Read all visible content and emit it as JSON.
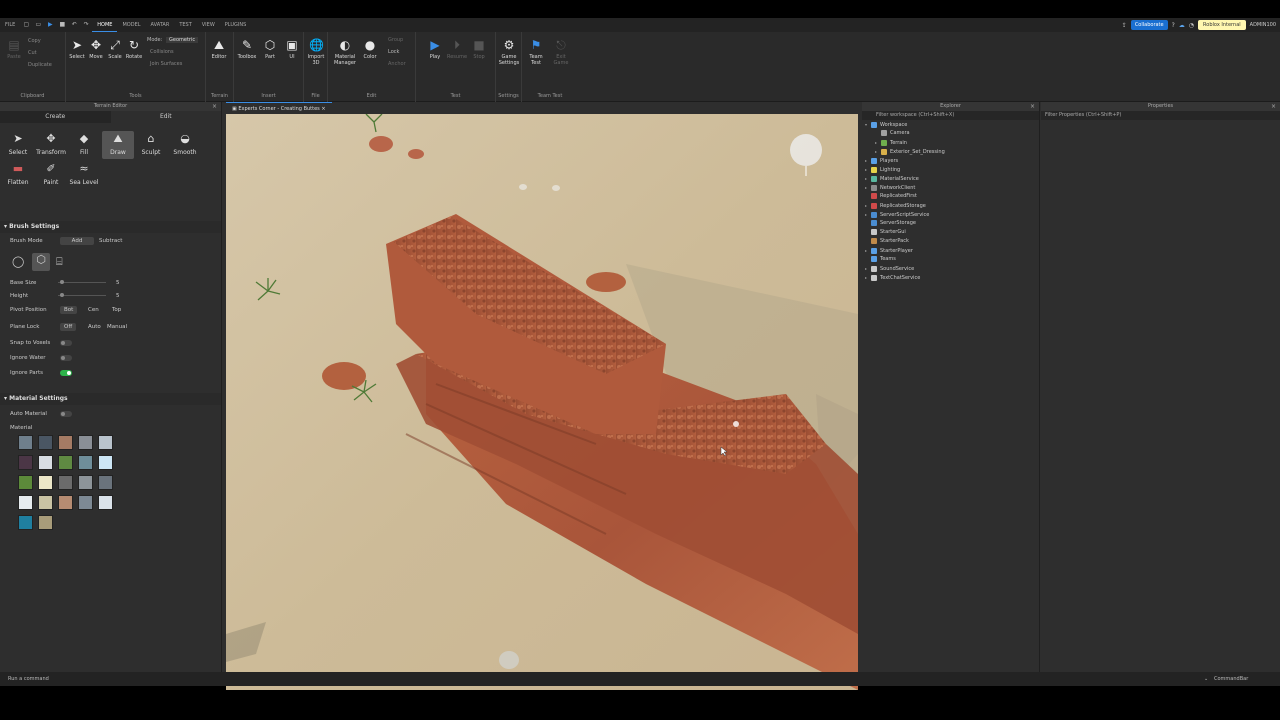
{
  "menubar": {
    "items": [
      "FILE",
      "HOME",
      "MODEL",
      "AVATAR",
      "TEST",
      "VIEW",
      "PLUGINS"
    ],
    "active": "HOME",
    "collaborate_label": "Collaborate",
    "internal_label": "Roblox Internal",
    "user": "ADMIN100"
  },
  "ribbon": {
    "clipboard": {
      "paste": "Paste",
      "copy": "Copy",
      "cut": "Cut",
      "duplicate": "Duplicate",
      "label": "Clipboard"
    },
    "tools": {
      "select": "Select",
      "move": "Move",
      "scale": "Scale",
      "rotate": "Rotate",
      "mode_label": "Mode:",
      "mode_value": "Geometric",
      "collisions": "Collisions",
      "join_surfaces": "Join Surfaces",
      "label": "Tools"
    },
    "terrain": {
      "editor": "Editor",
      "label": "Terrain"
    },
    "insert": {
      "toolbox": "Toolbox",
      "part": "Part",
      "ui": "UI",
      "label": "Insert"
    },
    "file": {
      "import3d": "Import 3D",
      "label": "File"
    },
    "edit": {
      "material_manager": "Material Manager",
      "color": "Color",
      "group": "Group",
      "lock": "Lock",
      "anchor": "Anchor",
      "label": "Edit"
    },
    "test": {
      "play": "Play",
      "resume": "Resume",
      "stop": "Stop",
      "label": "Test"
    },
    "settings": {
      "game_settings": "Game Settings",
      "label": "Settings"
    },
    "team_test": {
      "team_test": "Team Test",
      "exit_game": "Exit Game",
      "label": "Team Test"
    }
  },
  "terrain_editor": {
    "title": "Terrain Editor",
    "tabs": [
      "Create",
      "Edit"
    ],
    "active_tab": "Edit",
    "tools": [
      "Select",
      "Transform",
      "Fill",
      "Draw",
      "Sculpt",
      "Smooth",
      "Flatten",
      "Paint",
      "Sea Level"
    ],
    "selected_tool": "Draw",
    "brush_settings": {
      "header": "Brush Settings",
      "brush_mode_label": "Brush Mode",
      "brush_mode_options": [
        "Add",
        "Subtract"
      ],
      "brush_mode_value": "Add",
      "base_size_label": "Base Size",
      "base_size_value": "5",
      "height_label": "Height",
      "height_value": "5",
      "pivot_label": "Pivot Position",
      "pivot_options": [
        "Bot",
        "Cen",
        "Top"
      ],
      "pivot_value": "Bot",
      "plane_lock_label": "Plane Lock",
      "plane_lock_options": [
        "Off",
        "Auto",
        "Manual"
      ],
      "plane_lock_value": "Off",
      "snap_label": "Snap to Voxels",
      "ignore_water_label": "Ignore Water",
      "ignore_parts_label": "Ignore Parts"
    },
    "material_settings": {
      "header": "Material Settings",
      "auto_material_label": "Auto Material",
      "material_label": "Material",
      "swatches": [
        "#6f7f8c",
        "#4a5663",
        "#a57b64",
        "#8a8f96",
        "#b9c3cc",
        "#4b3646",
        "#d8dde3",
        "#5f8a42",
        "#6f8e9a",
        "#cde6f5",
        "#5c8a3a",
        "#ece7c8",
        "#6b6b6b",
        "#8d9499",
        "#6a737c",
        "#e6ecef",
        "#c9c3a4",
        "#b68c72",
        "#7d8994",
        "#dbe3ea",
        "#1f7fa0",
        "#a89c7a"
      ]
    }
  },
  "document_tab": "Experts Corner - Creating Buttes",
  "explorer": {
    "title": "Explorer",
    "filter_placeholder": "Filter workspace (Ctrl+Shift+X)",
    "items": [
      {
        "label": "Workspace",
        "depth": 0,
        "color": "#5aa0e6",
        "arrow": "▾"
      },
      {
        "label": "Camera",
        "depth": 1,
        "color": "#a0a0a0",
        "arrow": ""
      },
      {
        "label": "Terrain",
        "depth": 1,
        "color": "#6fae4d",
        "arrow": "▸"
      },
      {
        "label": "Exterior_Set_Dressing",
        "depth": 1,
        "color": "#d8b04a",
        "arrow": "▸"
      },
      {
        "label": "Players",
        "depth": 0,
        "color": "#5aa0e6",
        "arrow": "▸"
      },
      {
        "label": "Lighting",
        "depth": 0,
        "color": "#e6d24a",
        "arrow": "▸"
      },
      {
        "label": "MaterialService",
        "depth": 0,
        "color": "#5ab8a0",
        "arrow": "▸"
      },
      {
        "label": "NetworkClient",
        "depth": 0,
        "color": "#8c8c8c",
        "arrow": "▸"
      },
      {
        "label": "ReplicatedFirst",
        "depth": 0,
        "color": "#d04a4a",
        "arrow": ""
      },
      {
        "label": "ReplicatedStorage",
        "depth": 0,
        "color": "#d04a4a",
        "arrow": "▸"
      },
      {
        "label": "ServerScriptService",
        "depth": 0,
        "color": "#4a8cd0",
        "arrow": "▸"
      },
      {
        "label": "ServerStorage",
        "depth": 0,
        "color": "#4a8cd0",
        "arrow": ""
      },
      {
        "label": "StarterGui",
        "depth": 0,
        "color": "#c8c8c8",
        "arrow": ""
      },
      {
        "label": "StarterPack",
        "depth": 0,
        "color": "#c08a4a",
        "arrow": ""
      },
      {
        "label": "StarterPlayer",
        "depth": 0,
        "color": "#5aa0e6",
        "arrow": "▸"
      },
      {
        "label": "Teams",
        "depth": 0,
        "color": "#5aa0e6",
        "arrow": ""
      },
      {
        "label": "SoundService",
        "depth": 0,
        "color": "#c8c8c8",
        "arrow": "▸"
      },
      {
        "label": "TextChatService",
        "depth": 0,
        "color": "#c8c8c8",
        "arrow": "▸"
      }
    ]
  },
  "properties": {
    "title": "Properties",
    "filter_placeholder": "Filter Properties (Ctrl+Shift+P)"
  },
  "statusbar": {
    "command_placeholder": "Run a command",
    "commandbar_label": "CommandBar"
  }
}
